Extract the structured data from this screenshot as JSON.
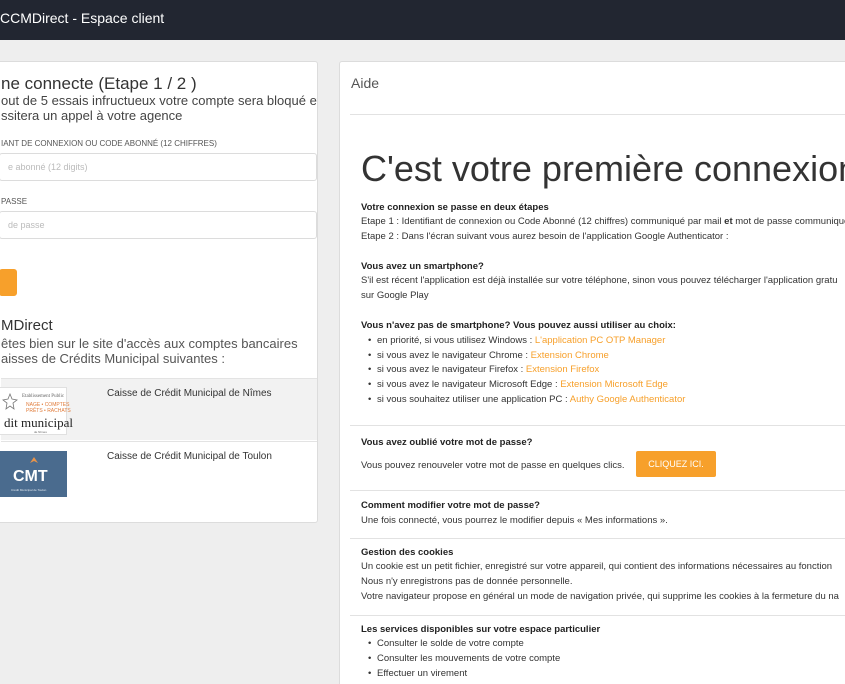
{
  "topbar": {
    "title": "CCMDirect - Espace client"
  },
  "login": {
    "title": "ne connecte (Etape 1 / 2 )",
    "warning": "out de 5 essais infructueux votre compte sera bloqué et ssitera un appel à votre agence",
    "id_label": "IANT DE CONNEXION OU CODE ABONNÉ (12 CHIFFRES)",
    "id_placeholder": "e abonné (12 digits)",
    "pwd_label": " PASSE",
    "pwd_placeholder": "de passe",
    "site_title": "MDirect",
    "site_desc": "êtes bien sur le site d'accès aux comptes bancaires aisses de Crédits Municipal suivantes :",
    "banks": [
      {
        "name": "Caisse de Crédit Municipal de Nîmes",
        "logo": {
          "l1": "Etablissement Public",
          "l2": "NAGE • COMPTES",
          "l3": "PRÊTS • RACHATS",
          "l4": "dit municipal",
          "l5": "de Nîmes"
        }
      },
      {
        "name": "Caisse de Crédit Municipal de Toulon",
        "logo": {
          "text": "CMT",
          "sub": "Crédit Municipal de Toulon"
        }
      }
    ]
  },
  "aide": {
    "title": "Aide",
    "big_title": "C'est votre première connexion",
    "s1_title": "Votre connexion se passe en deux étapes",
    "s1_line1a": "Etape 1 : Identifiant de connexion ou Code Abonné (12 chiffres) communiqué par mail ",
    "s1_line1b": "et",
    "s1_line1c": " mot de passe communiqué",
    "s1_line2": "Etape 2 : Dans l'écran suivant vous aurez besoin de l'application Google Authenticator :",
    "s2_title": "Vous avez un smartphone?",
    "s2_line1": "S'il est récent l'application est déjà installée sur votre téléphone, sinon vous pouvez télécharger l'application gratu",
    "s2_line2": "sur Google Play",
    "s3_title": "Vous n'avez pas de smartphone? Vous pouvez aussi utiliser au choix:",
    "s3_items": [
      {
        "text": "en priorité, si vous utilisez Windows : ",
        "link": "L'application PC OTP Manager"
      },
      {
        "text": "si vous avez le navigateur Chrome : ",
        "link": "Extension Chrome"
      },
      {
        "text": "si vous avez le navigateur Firefox : ",
        "link": "Extension Firefox"
      },
      {
        "text": "si vous avez le navigateur Microsoft Edge : ",
        "link": "Extension Microsoft Edge"
      },
      {
        "text": "si vous souhaitez utiliser une application PC : ",
        "link": "Authy Google Authenticator"
      }
    ],
    "s4_title": "Vous avez oublié votre mot de passe?",
    "s4_line": "Vous pouvez renouveler votre mot de passe en quelques clics.",
    "s4_button": "CLIQUEZ ICI.",
    "s5_title": "Comment modifier votre mot de passe?",
    "s5_line": "Une fois connecté, vous pourrez le modifier depuis « Mes informations ».",
    "s6_title": "Gestion des cookies",
    "s6_line1": "Un cookie est un petit fichier, enregistré sur votre appareil, qui contient des informations nécessaires au fonction",
    "s6_line2": "Nous n'y enregistrons pas de donnée personnelle.",
    "s6_line3": "Votre navigateur propose en général un mode de navigation privée, qui supprime les cookies à la fermeture du na",
    "s7_title": "Les services disponibles sur votre espace particulier",
    "s7_items": [
      "Consulter le solde de votre compte",
      "Consulter les mouvements de votre compte",
      "Effectuer un virement"
    ]
  },
  "colors": {
    "topbar": "#222631",
    "accent": "#f7a02b",
    "background": "#eeeeee"
  }
}
